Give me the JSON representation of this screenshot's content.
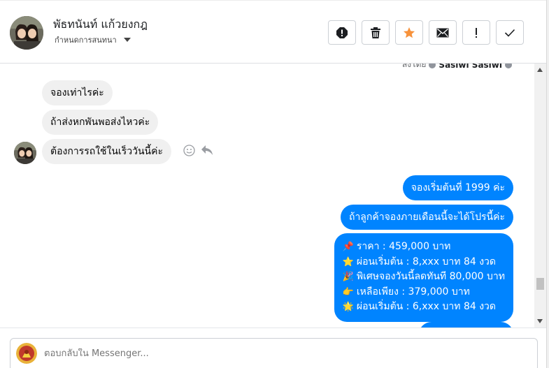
{
  "header": {
    "contact_name": "พัธทนันท์ แก้วยงกฎ",
    "settings_label": "กำหนดการสนทนา",
    "actions": [
      {
        "name": "report-button",
        "icon": "alert-circle-icon"
      },
      {
        "name": "delete-button",
        "icon": "trash-icon"
      },
      {
        "name": "star-button",
        "icon": "star-icon"
      },
      {
        "name": "mark-unread-button",
        "icon": "envelope-icon"
      },
      {
        "name": "important-button",
        "icon": "exclamation-icon"
      },
      {
        "name": "done-button",
        "icon": "checkmark-icon"
      }
    ]
  },
  "messages": {
    "sent_by_prefix": "ส่งโดย",
    "sent_by_name": "Sasiwi Sasiwi",
    "incoming": [
      "จองเท่าไรค่ะ",
      "ถ้าส่งหกพันพอส่งไหวค่ะ",
      "ต้องการรถใช้ในเร็ววันนี้ค่ะ"
    ],
    "outgoing": [
      "จองเริ่มต้นที่ 1999 ค่ะ",
      "ถ้าลูกค้าจองภายเดือนนี้จะได้โปรนี้ค่ะ"
    ],
    "promo": [
      {
        "emoji": "📌",
        "text": "ราคา : 459,000 บาท"
      },
      {
        "emoji": "⭐",
        "text": "ผ่อนเริ่มต้น : 8,xxx บาท 84 งวด"
      },
      {
        "emoji": "🎉",
        "text": "พิเศษจองวันนี้ลดทันที 80,000 บาท"
      },
      {
        "emoji": "👉",
        "text": "เหลือเพียง : 379,000 บาท"
      },
      {
        "emoji": "🌟",
        "text": "ผ่อนเริ่มต้น : 6,xxx บาท 84 งวด"
      }
    ]
  },
  "composer": {
    "placeholder": "ตอบกลับใน Messenger..."
  },
  "colors": {
    "outgoing_bubble": "#0084ff",
    "incoming_bubble": "#f0f0f0",
    "star_active": "#f7923b"
  }
}
